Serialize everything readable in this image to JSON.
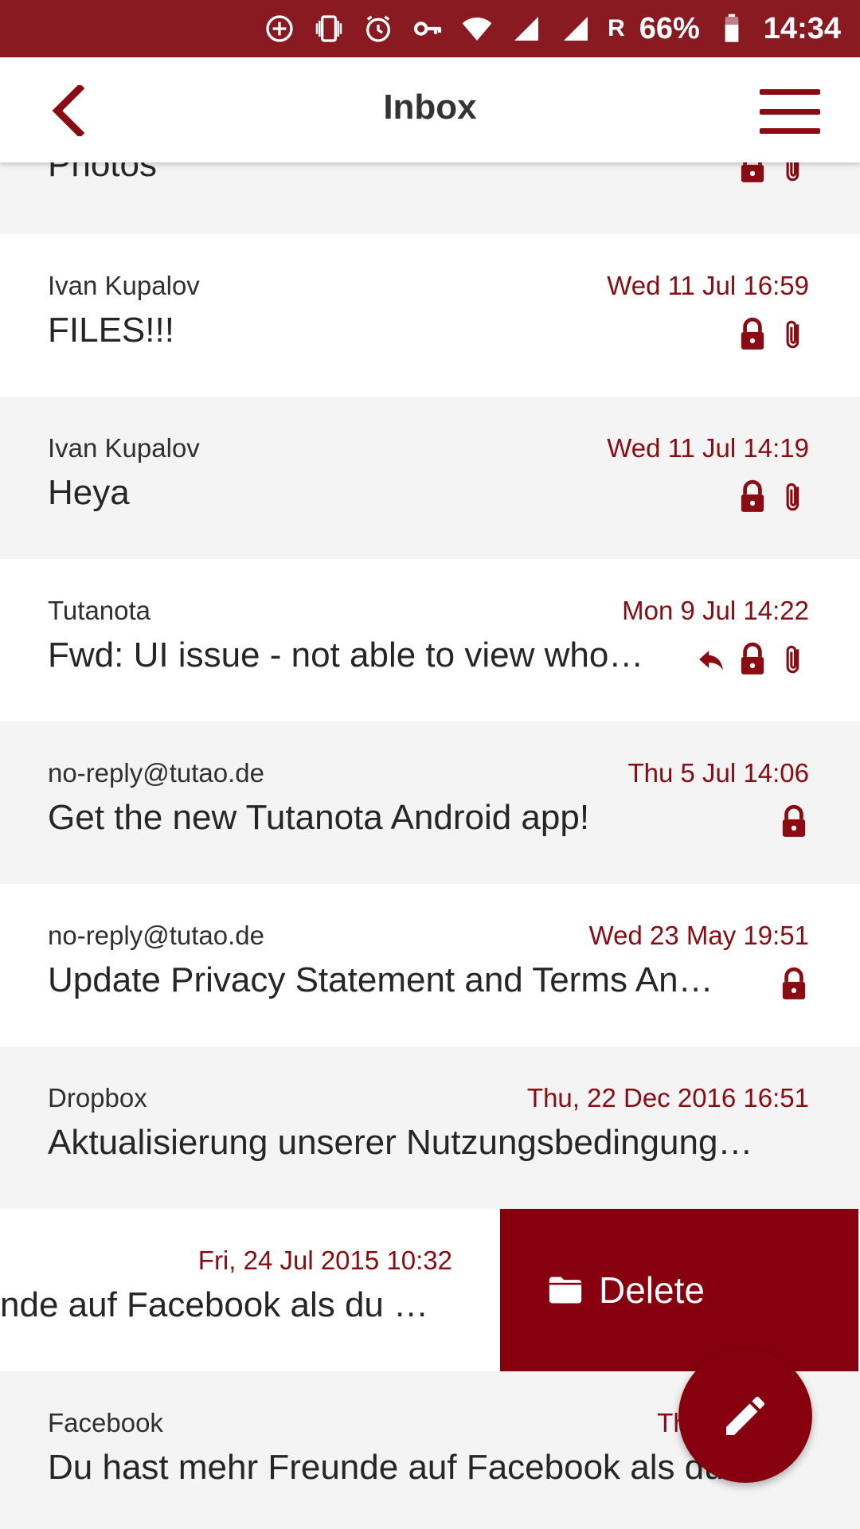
{
  "status_bar": {
    "icons": [
      "add-circle-icon",
      "vibrate-icon",
      "alarm-icon",
      "vpn-key-icon",
      "wifi-icon",
      "signal-icon",
      "signal-icon"
    ],
    "roaming": "R",
    "battery": "66%",
    "time": "14:34"
  },
  "header": {
    "title": "Inbox",
    "back_icon": "chevron-left-icon",
    "menu_icon": "hamburger-menu-icon"
  },
  "colors": {
    "brand": "#8a0b12",
    "status_bar": "#8a1a22",
    "delete_action": "#860010"
  },
  "mails": [
    {
      "sender": "",
      "date": "",
      "subject": "Photos",
      "icons": [
        "lock-icon",
        "attachment-icon"
      ]
    },
    {
      "sender": "Ivan Kupalov",
      "date": "Wed 11 Jul 16:59",
      "subject": "FILES!!!",
      "icons": [
        "lock-icon",
        "attachment-icon"
      ]
    },
    {
      "sender": "Ivan Kupalov",
      "date": "Wed 11 Jul 14:19",
      "subject": "Heya",
      "icons": [
        "lock-icon",
        "attachment-icon"
      ]
    },
    {
      "sender": "Tutanota",
      "date": "Mon 9 Jul 14:22",
      "subject": "Fwd: UI issue - not able to view who…",
      "icons": [
        "reply-icon",
        "lock-icon",
        "attachment-icon"
      ]
    },
    {
      "sender": "no-reply@tutao.de",
      "date": "Thu 5 Jul 14:06",
      "subject": "Get the new Tutanota Android app!",
      "icons": [
        "lock-icon"
      ]
    },
    {
      "sender": "no-reply@tutao.de",
      "date": "Wed 23 May 19:51",
      "subject": "Update Privacy Statement and Terms An…",
      "icons": [
        "lock-icon"
      ]
    },
    {
      "sender": "Dropbox",
      "date": "Thu, 22 Dec 2016 16:51",
      "subject": "Aktualisierung unserer Nutzungsbedingung…",
      "icons": []
    },
    {
      "sender": "",
      "date": "Fri, 24 Jul 2015 10:32",
      "subject": "nde auf Facebook als du …",
      "icons": []
    },
    {
      "sender": "Facebook",
      "date": "Thu, 23 Jul 2",
      "subject": "Du hast mehr Freunde auf Facebook als du …",
      "icons": []
    }
  ],
  "swipe_action": {
    "label": "Delete",
    "icon": "folder-icon"
  },
  "fab": {
    "icon": "pencil-icon"
  }
}
